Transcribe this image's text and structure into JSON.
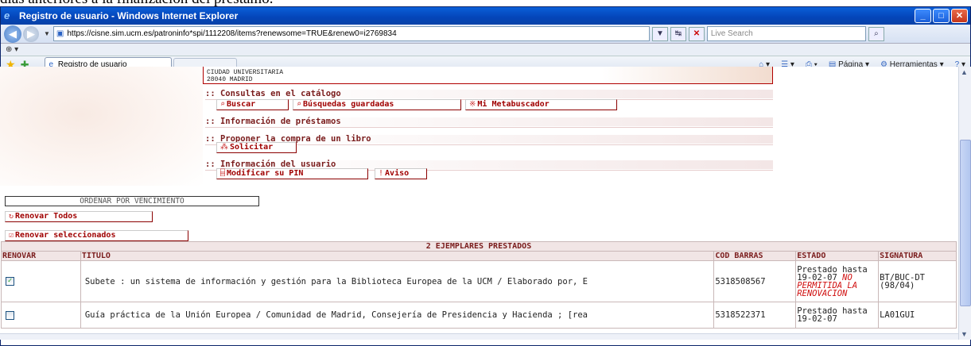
{
  "doc_caption": "días anteriores a la finalización del préstamo.",
  "window": {
    "title": "Registro de usuario - Windows Internet Explorer",
    "minimize": "_",
    "maximize": "□",
    "close": "✕"
  },
  "address": {
    "url": "https://cisne.sim.ucm.es/patroninfo*spi/1112208/items?renewsome=TRUE&renew0=i2769834",
    "search_placeholder": "Live Search"
  },
  "tabs": {
    "active_tab": "Registro de usuario",
    "pagina": "Página",
    "herramientas": "Herramientas"
  },
  "page": {
    "address_line1": "CIUDAD UNIVERSITARIA",
    "address_line2": "28040 MADRID",
    "sections": {
      "consultas": ":: Consultas en el catálogo",
      "informacion_prestamos": ":: Información de préstamos",
      "proponer": ":: Proponer la compra de un libro",
      "info_usuario": ":: Información del usuario"
    },
    "buttons": {
      "buscar": "Buscar",
      "busquedas_guardadas": "Búsquedas guardadas",
      "metabuscador": "Mi Metabuscador",
      "solicitar": "Solicitar",
      "modificar_pin": "Modificar su PIN",
      "aviso": "Aviso",
      "ordenar": "ORDENAR POR VENCIMIENTO",
      "renovar_todos": "Renovar Todos",
      "renovar_seleccionados": "Renovar seleccionados"
    }
  },
  "loans": {
    "caption": "2 EJEMPLARES PRESTADOS",
    "headers": {
      "renovar": "RENOVAR",
      "titulo": "TITULO",
      "cod_barras": "COD BARRAS",
      "estado": "ESTADO",
      "signatura": "SIGNATURA"
    },
    "rows": [
      {
        "checked": true,
        "title": "Subete : un sistema de información y gestión para la Biblioteca Europea de la UCM / Elaborado por, E",
        "barcode": "5318508567",
        "status": "Prestado hasta 19-02-07",
        "status_warning": "NO PERMITIDA LA RENOVACION",
        "signature": "BT/BUC-DT (98/04)"
      },
      {
        "checked": false,
        "title": "Guía práctica de la Unión Europea / Comunidad de Madrid, Consejería de Presidencia y Hacienda ; [rea",
        "barcode": "5318522371",
        "status": "Prestado hasta 19-02-07",
        "status_warning": "",
        "signature": "LA01GUI"
      }
    ]
  }
}
